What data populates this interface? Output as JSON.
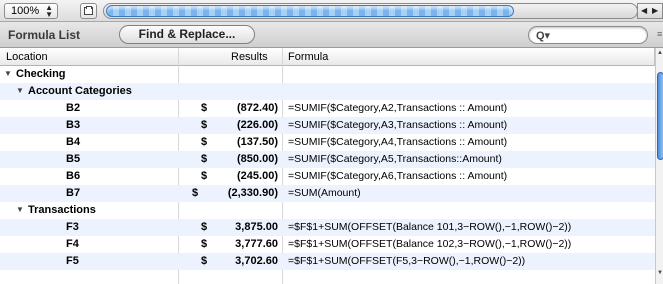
{
  "toolbar": {
    "zoom_value": "100%",
    "zoom_stepper_glyph": "⇕",
    "page_icon": "page-icon",
    "scroll_left_arrow": "◀",
    "scroll_right_arrow": "▶"
  },
  "subtoolbar": {
    "title": "Formula List",
    "find_replace_label": "Find & Replace...",
    "search_placeholder": "Q▾"
  },
  "table": {
    "columns": [
      "Location",
      "Results",
      "Formula"
    ],
    "rows": [
      {
        "kind": "group",
        "level": 0,
        "label": "Checking",
        "expander": "▼",
        "dollar": "",
        "amount": "",
        "formula": ""
      },
      {
        "kind": "group",
        "level": 1,
        "label": "Account Categories",
        "expander": "▼",
        "dollar": "",
        "amount": "",
        "formula": ""
      },
      {
        "kind": "cell",
        "label": "B2",
        "dollar": "$",
        "amount": "(872.40)",
        "formula": "=SUMIF($Category,A2,Transactions :: Amount)"
      },
      {
        "kind": "cell",
        "label": "B3",
        "dollar": "$",
        "amount": "(226.00)",
        "formula": "=SUMIF($Category,A3,Transactions :: Amount)"
      },
      {
        "kind": "cell",
        "label": "B4",
        "dollar": "$",
        "amount": "(137.50)",
        "formula": "=SUMIF($Category,A4,Transactions :: Amount)"
      },
      {
        "kind": "cell",
        "label": "B5",
        "dollar": "$",
        "amount": "(850.00)",
        "formula": "=SUMIF($Category,A5,Transactions::Amount)"
      },
      {
        "kind": "cell",
        "label": "B6",
        "dollar": "$",
        "amount": "(245.00)",
        "formula": "=SUMIF($Category,A6,Transactions :: Amount)"
      },
      {
        "kind": "cell",
        "label": "B7",
        "dollar": "$",
        "amount": "(2,330.90)",
        "formula": "=SUM(Amount)"
      },
      {
        "kind": "group",
        "level": 1,
        "label": "Transactions",
        "expander": "▼",
        "dollar": "",
        "amount": "",
        "formula": ""
      },
      {
        "kind": "cell",
        "label": "F3",
        "dollar": "$",
        "amount": "3,875.00",
        "formula": "=$F$1+SUM(OFFSET(Balance 101,3−ROW(),−1,ROW()−2))"
      },
      {
        "kind": "cell",
        "label": "F4",
        "dollar": "$",
        "amount": "3,777.60",
        "formula": "=$F$1+SUM(OFFSET(Balance 102,3−ROW(),−1,ROW()−2))"
      },
      {
        "kind": "cell",
        "label": "F5",
        "dollar": "$",
        "amount": "3,702.60",
        "formula": "=$F$1+SUM(OFFSET(F5,3−ROW(),−1,ROW()−2))"
      }
    ]
  },
  "colors": {
    "row_alt": "#edf3fe",
    "scroll_thumb": "#7ab4ea"
  }
}
